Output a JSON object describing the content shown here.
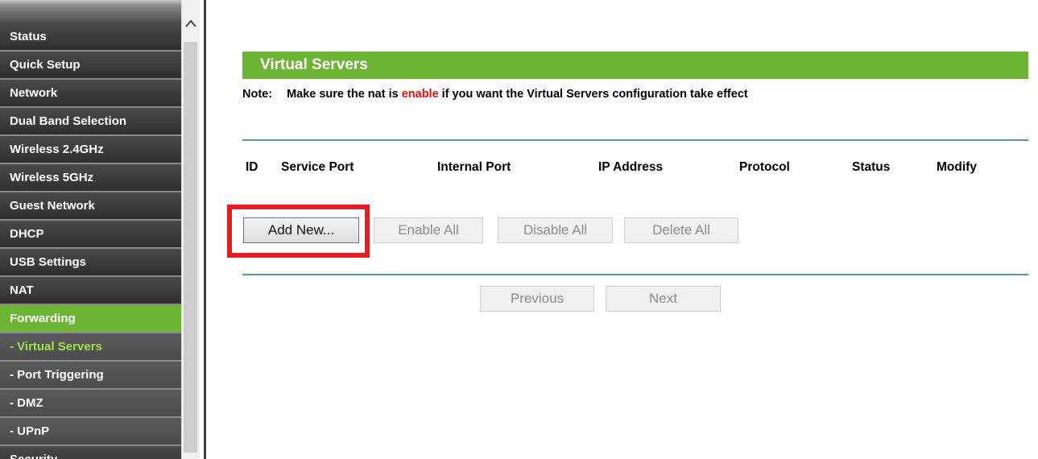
{
  "sidebar": {
    "items": [
      {
        "label": "Status",
        "type": "main"
      },
      {
        "label": "Quick Setup",
        "type": "main"
      },
      {
        "label": "Network",
        "type": "main"
      },
      {
        "label": "Dual Band Selection",
        "type": "main"
      },
      {
        "label": "Wireless 2.4GHz",
        "type": "main"
      },
      {
        "label": "Wireless 5GHz",
        "type": "main"
      },
      {
        "label": "Guest Network",
        "type": "main"
      },
      {
        "label": "DHCP",
        "type": "main"
      },
      {
        "label": "USB Settings",
        "type": "main"
      },
      {
        "label": "NAT",
        "type": "main"
      },
      {
        "label": "Forwarding",
        "type": "active-parent"
      },
      {
        "label": "- Virtual Servers",
        "type": "active-sub"
      },
      {
        "label": "- Port Triggering",
        "type": "sub"
      },
      {
        "label": "- DMZ",
        "type": "sub"
      },
      {
        "label": "- UPnP",
        "type": "sub"
      },
      {
        "label": "Security",
        "type": "main"
      }
    ]
  },
  "scrollbar": {
    "up_icon": "chevron-up-icon"
  },
  "page": {
    "title": "Virtual Servers",
    "note": {
      "prefix": "Note:",
      "text_before": "Make sure the nat is ",
      "highlight": "enable",
      "text_after": " if you want the Virtual Servers configuration take effect"
    },
    "table": {
      "headers": {
        "id": "ID",
        "service_port": "Service Port",
        "internal_port": "Internal Port",
        "ip_address": "IP Address",
        "protocol": "Protocol",
        "status": "Status",
        "modify": "Modify"
      }
    },
    "buttons": {
      "add_new": "Add New...",
      "enable_all": "Enable All",
      "disable_all": "Disable All",
      "delete_all": "Delete All",
      "previous": "Previous",
      "next": "Next"
    }
  },
  "colors": {
    "accent_green": "#6cb534",
    "highlight_red": "#e41d25",
    "note_red": "#e30f0f",
    "active_sub_text": "#9fe34a"
  }
}
